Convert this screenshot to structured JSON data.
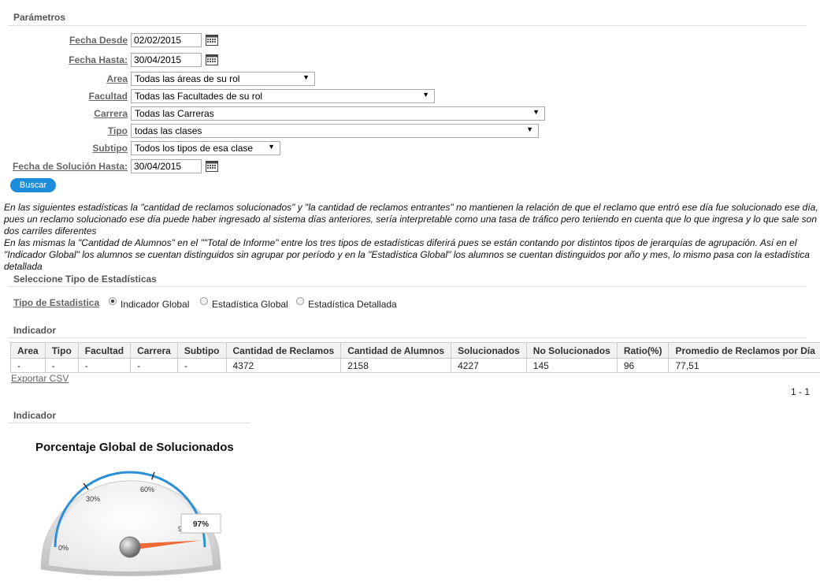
{
  "params": {
    "title": "Parámetros",
    "fecha_desde": {
      "label": "Fecha Desde",
      "value": "02/02/2015"
    },
    "fecha_hasta": {
      "label": "Fecha Hasta:",
      "value": "30/04/2015"
    },
    "area": {
      "label": "Area",
      "value": "Todas las áreas de su rol"
    },
    "facultad": {
      "label": "Facultad",
      "value": "Todas las Facultades de su rol"
    },
    "carrera": {
      "label": "Carrera",
      "value": "Todas las Carreras"
    },
    "tipo": {
      "label": "Tipo",
      "value": "todas las clases"
    },
    "subtipo": {
      "label": "Subtipo",
      "value": "Todos los tipos de esa clase"
    },
    "fecha_solucion": {
      "label": "Fecha de Solución Hasta:",
      "value": "30/04/2015"
    },
    "search_label": "Buscar"
  },
  "note": "En las siguientes estadísticas la \"cantidad de reclamos solucionados\" y \"la cantidad de reclamos entrantes\" no mantienen la relación de que el reclamo que entró ese día fue solucionado ese día, pues un reclamo solucionado ese día puede haber ingresado al sistema días anteriores, sería interpretable como una tasa de tráfico pero teniendo en cuenta que lo que ingresa y lo que sale son dos carriles diferentes\nEn las mismas la \"Cantidad de Alumnos\" en el \"\"Total de Informe\" entre los tres tipos de estadísticas diferirá pues se están contando por distintos tipos de jerarquías de agrupación. Así en el \"Indicador Global\" los alumnos se cuentan distinguidos sin agrupar por período y en la \"Estadística Global\" los alumnos se cuentan distinguidos por año y mes, lo mismo pasa con la estadística detallada",
  "stats_type": {
    "title": "Seleccione Tipo de Estadísticas",
    "label": "Tipo de Estadistica",
    "options": [
      "Indicador Global",
      "Estadística Global",
      "Estadística Detallada"
    ],
    "selected": "Indicador Global"
  },
  "indicator_table": {
    "title": "Indicador",
    "headers": [
      "Area",
      "Tipo",
      "Facultad",
      "Carrera",
      "Subtipo",
      "Cantidad de Reclamos",
      "Cantidad de Alumnos",
      "Solucionados",
      "No Solucionados",
      "Ratio(%)",
      "Promedio de Reclamos por Día"
    ],
    "rows": [
      [
        "-",
        "-",
        "-",
        "-",
        "-",
        "4372",
        "2158",
        "4227",
        "145",
        "96",
        "77,51"
      ]
    ],
    "export_label": "Exportar CSV",
    "pagination": "1 - 1"
  },
  "gauge": {
    "section_title": "Indicador",
    "title": "Porcentaje Global de Solucionados",
    "tick_labels": [
      "0%",
      "30%",
      "60%",
      "9"
    ],
    "value_label": "97%",
    "value": 97,
    "colors": {
      "arc": "#2d8fd5",
      "needle": "#f06a35"
    }
  }
}
